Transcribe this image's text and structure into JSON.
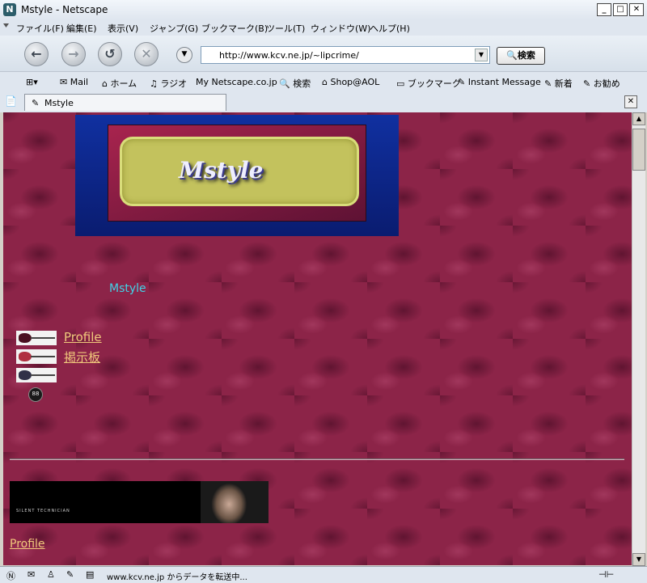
{
  "window": {
    "title": "Mstyle - Netscape",
    "app_icon": "N"
  },
  "menu": [
    "ファイル(F)",
    "編集(E)",
    "表示(V)",
    "ジャンプ(G)",
    "ブックマーク(B)",
    "ツール(T)",
    "ウィンドウ(W)",
    "ヘルプ(H)"
  ],
  "nav": {
    "url": "http://www.kcv.ne.jp/~lipcrime/",
    "search_label": "検索"
  },
  "personal": [
    {
      "icon": "mail-icon",
      "label": "Mail"
    },
    {
      "icon": "home-icon",
      "label": "ホーム"
    },
    {
      "icon": "radio-icon",
      "label": "ラジオ"
    },
    {
      "icon": "my-netscape-icon",
      "label": "Netscape.co.jp"
    },
    {
      "icon": "search-icon",
      "label": "検索"
    },
    {
      "icon": "shop-icon",
      "label": "Shop@AOL"
    },
    {
      "icon": "bookmark-folder-icon",
      "label": "ブックマーク"
    },
    {
      "icon": "bookmark-icon",
      "label": "Instant Message"
    },
    {
      "icon": "bookmark-icon",
      "label": "新着"
    },
    {
      "icon": "bookmark-icon",
      "label": "お勧め"
    }
  ],
  "tab": {
    "label": "Mstyle"
  },
  "page": {
    "banner_logo": "Mstyle",
    "site_name": "Mstyle",
    "links": [
      "Profile",
      "掲示板"
    ],
    "photo_caption": "SILENT TECHNICIAN",
    "bottom_link": "Profile",
    "counter_label": "88",
    "colors": {
      "background": "#8c2448",
      "link": "#f1c97c",
      "site_name": "#41d2e6"
    }
  },
  "status": {
    "text": "www.kcv.ne.jp からデータを転送中..."
  }
}
